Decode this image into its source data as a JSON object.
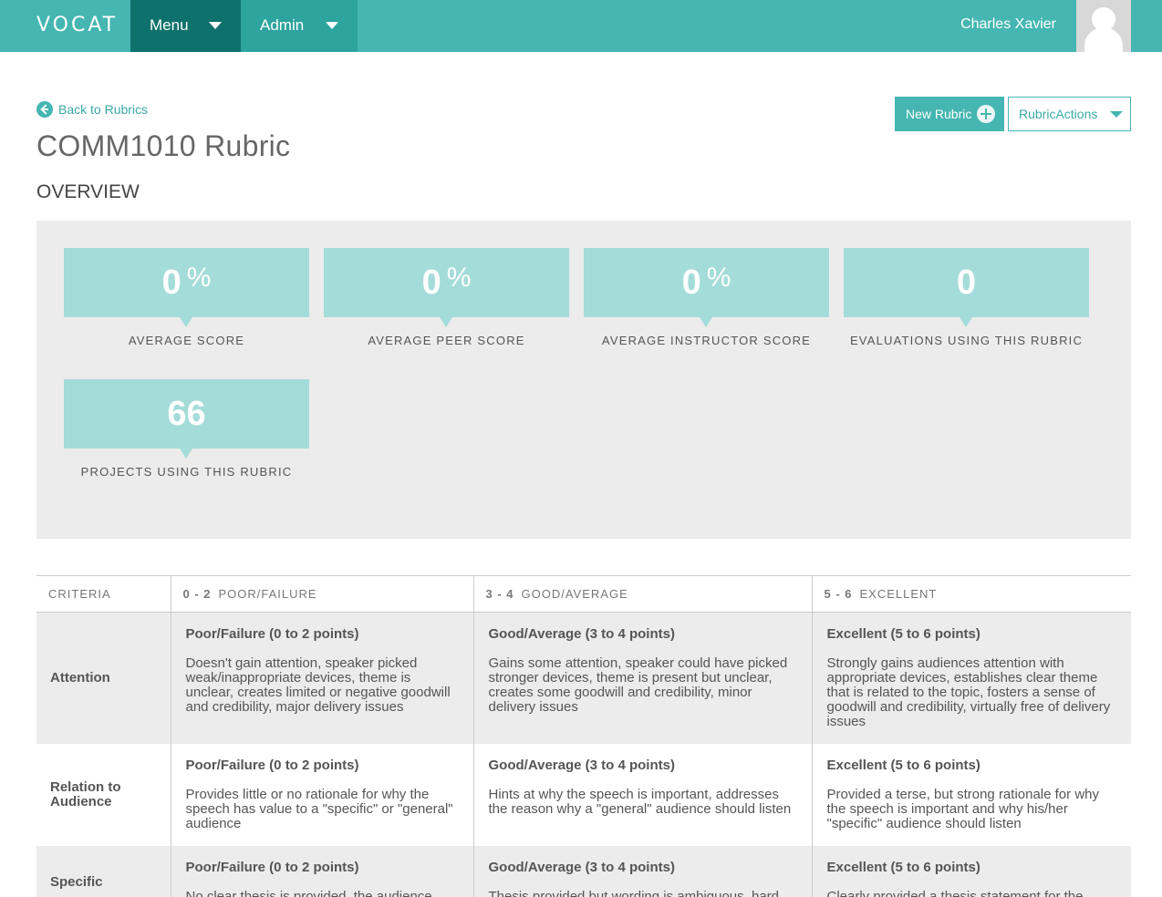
{
  "topbar": {
    "logo": "VOCAT",
    "menu_label": "Menu",
    "admin_label": "Admin",
    "username": "Charles Xavier"
  },
  "header": {
    "back_label": "Back to Rubrics",
    "title": "COMM1010 Rubric",
    "section": "OVERVIEW",
    "new_rubric_label": "New Rubric",
    "actions_label": "RubricActions"
  },
  "stats": [
    {
      "value": "0",
      "unit": "%",
      "label": "AVERAGE SCORE"
    },
    {
      "value": "0",
      "unit": "%",
      "label": "AVERAGE PEER SCORE"
    },
    {
      "value": "0",
      "unit": "%",
      "label": "AVERAGE INSTRUCTOR SCORE"
    },
    {
      "value": "0",
      "unit": "",
      "label": "EVALUATIONS USING THIS RUBRIC"
    },
    {
      "value": "66",
      "unit": "",
      "label": "PROJECTS USING THIS RUBRIC"
    }
  ],
  "rubric": {
    "columns": [
      {
        "range": "",
        "label": "CRITERIA"
      },
      {
        "range": "0 - 2",
        "label": "POOR/FAILURE"
      },
      {
        "range": "3 - 4",
        "label": "GOOD/AVERAGE"
      },
      {
        "range": "5 - 6",
        "label": "EXCELLENT"
      }
    ],
    "rows": [
      {
        "criteria": "Attention",
        "cells": [
          {
            "title": "Poor/Failure (0 to 2 points)",
            "text": "Doesn't gain attention, speaker picked weak/inappropriate devices, theme is unclear, creates limited or negative goodwill and credibility, major delivery issues"
          },
          {
            "title": "Good/Average (3 to 4 points)",
            "text": "Gains some attention, speaker could have picked stronger devices, theme is present but unclear, creates some goodwill and credibility, minor delivery issues"
          },
          {
            "title": "Excellent (5 to 6 points)",
            "text": "Strongly gains audiences attention with appropriate devices, establishes clear theme that is related to the topic, fosters a sense of goodwill and credibility, virtually free of delivery issues"
          }
        ]
      },
      {
        "criteria": "Relation to Audience",
        "cells": [
          {
            "title": "Poor/Failure (0 to 2 points)",
            "text": "Provides little or no rationale for why the speech has value to a \"specific\" or \"general\" audience"
          },
          {
            "title": "Good/Average (3 to 4 points)",
            "text": "Hints at why the speech is important, addresses the reason why a \"general\" audience should listen"
          },
          {
            "title": "Excellent (5 to 6 points)",
            "text": "Provided a terse, but strong rationale for why the speech is important and why his/her \"specific\" audience should listen"
          }
        ]
      },
      {
        "criteria": "Specific",
        "cells": [
          {
            "title": "Poor/Failure (0 to 2 points)",
            "text": "No clear thesis is provided, the audience"
          },
          {
            "title": "Good/Average (3 to 4 points)",
            "text": "Thesis provided but wording is ambiguous, hard"
          },
          {
            "title": "Excellent (5 to 6 points)",
            "text": "Clearly provided a thesis statement for the"
          }
        ]
      }
    ]
  }
}
